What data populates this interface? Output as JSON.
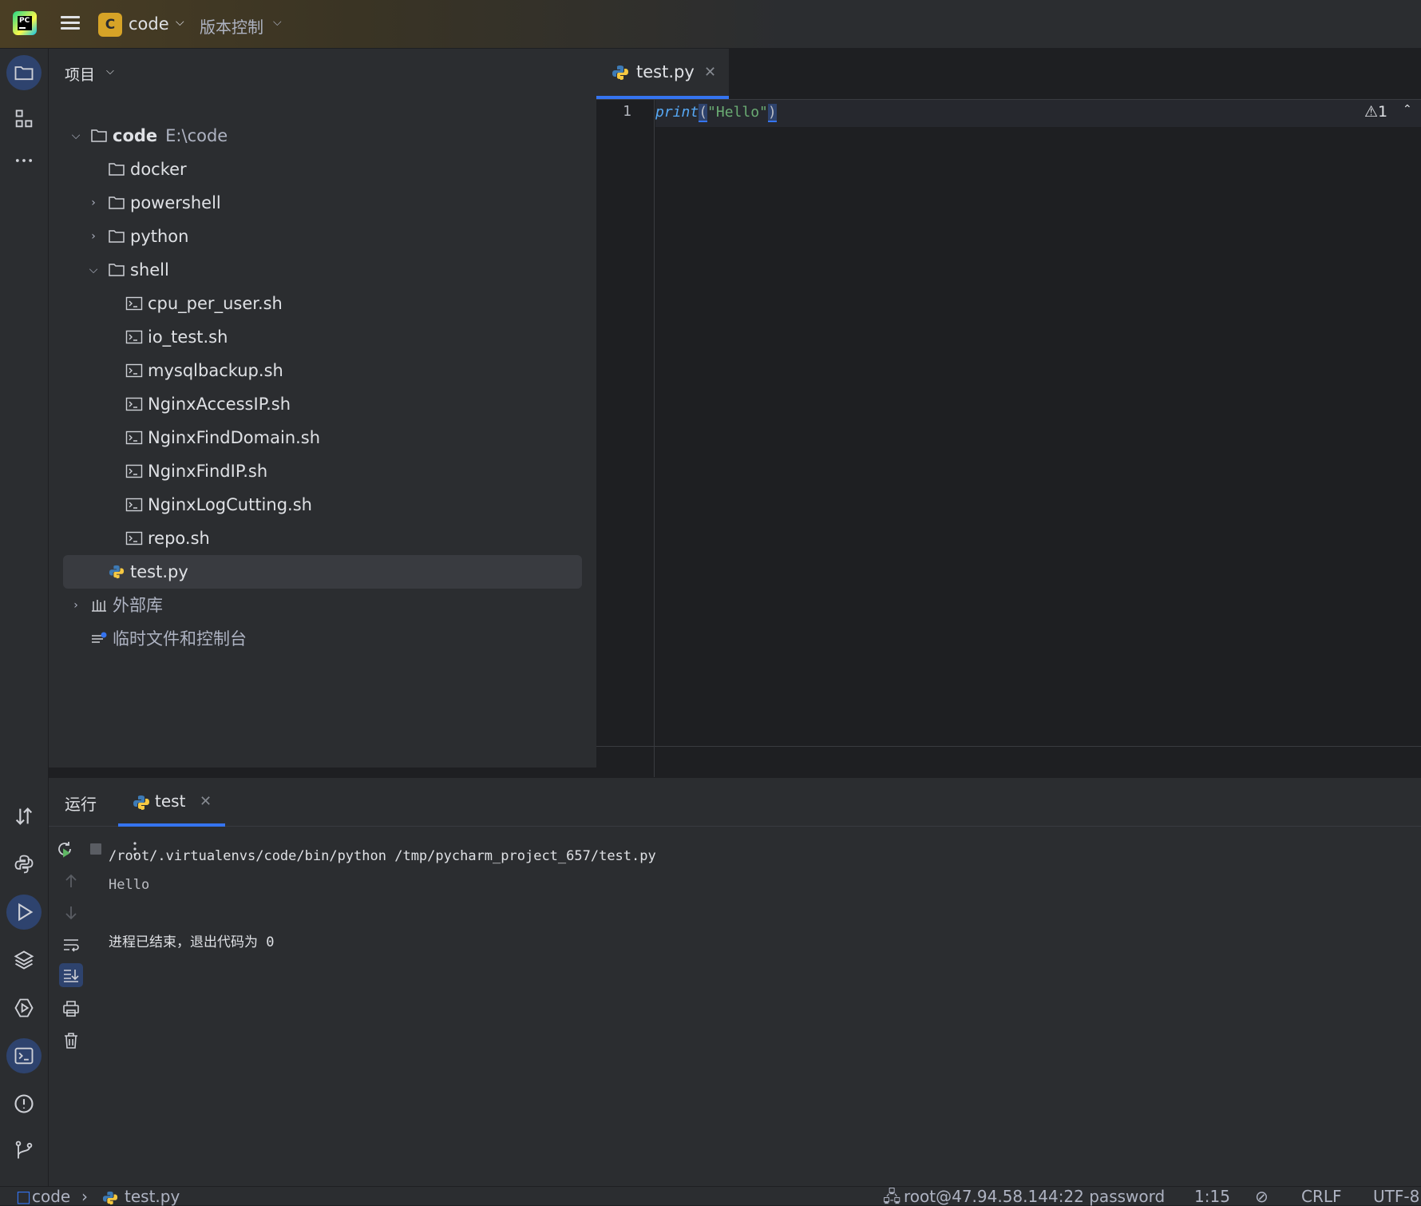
{
  "titlebar": {
    "project_badge": "C",
    "project_name": "code",
    "vcs_label": "版本控制"
  },
  "project_pane": {
    "header": "项目",
    "tree": [
      {
        "label": "code",
        "sub": "E:\\code",
        "type": "folder",
        "expanded": true,
        "depth": 0
      },
      {
        "label": "docker",
        "type": "folder",
        "depth": 1
      },
      {
        "label": "powershell",
        "type": "folder",
        "expanded": false,
        "depth": 1
      },
      {
        "label": "python",
        "type": "folder",
        "expanded": false,
        "depth": 1
      },
      {
        "label": "shell",
        "type": "folder",
        "expanded": true,
        "depth": 1
      },
      {
        "label": "cpu_per_user.sh",
        "type": "shell",
        "depth": 2
      },
      {
        "label": "io_test.sh",
        "type": "shell",
        "depth": 2
      },
      {
        "label": "mysqlbackup.sh",
        "type": "shell",
        "depth": 2
      },
      {
        "label": "NginxAccessIP.sh",
        "type": "shell",
        "depth": 2
      },
      {
        "label": "NginxFindDomain.sh",
        "type": "shell",
        "depth": 2
      },
      {
        "label": "NginxFindIP.sh",
        "type": "shell",
        "depth": 2
      },
      {
        "label": "NginxLogCutting.sh",
        "type": "shell",
        "depth": 2
      },
      {
        "label": "repo.sh",
        "type": "shell",
        "depth": 2
      },
      {
        "label": "test.py",
        "type": "python",
        "depth": 1,
        "selected": true
      },
      {
        "label": "外部库",
        "type": "library",
        "expanded": false,
        "depth": 0
      },
      {
        "label": "临时文件和控制台",
        "type": "scratch",
        "depth": 0
      }
    ]
  },
  "editor": {
    "tab_label": "test.py",
    "line_number": "1",
    "code": {
      "fn": "print",
      "open": "(",
      "string": "\"Hello\"",
      "close": ")"
    },
    "inspection_count": "1"
  },
  "run_panel": {
    "title": "运行",
    "tab_label": "test",
    "console": {
      "command": "/root/.virtualenvs/code/bin/python /tmp/pycharm_project_657/test.py",
      "output": "Hello",
      "exit": "进程已结束，退出代码为 0"
    }
  },
  "statusbar": {
    "breadcrumb_root": "code",
    "breadcrumb_file": "test.py",
    "interpreter": "root@47.94.58.144:22 password",
    "position": "1:15",
    "line_separator": "CRLF",
    "encoding": "UTF-8"
  },
  "colors": {
    "accent": "#3574f0",
    "background": "#1e1f22",
    "panel": "#2b2d30",
    "project_badge": "#d6a327"
  }
}
